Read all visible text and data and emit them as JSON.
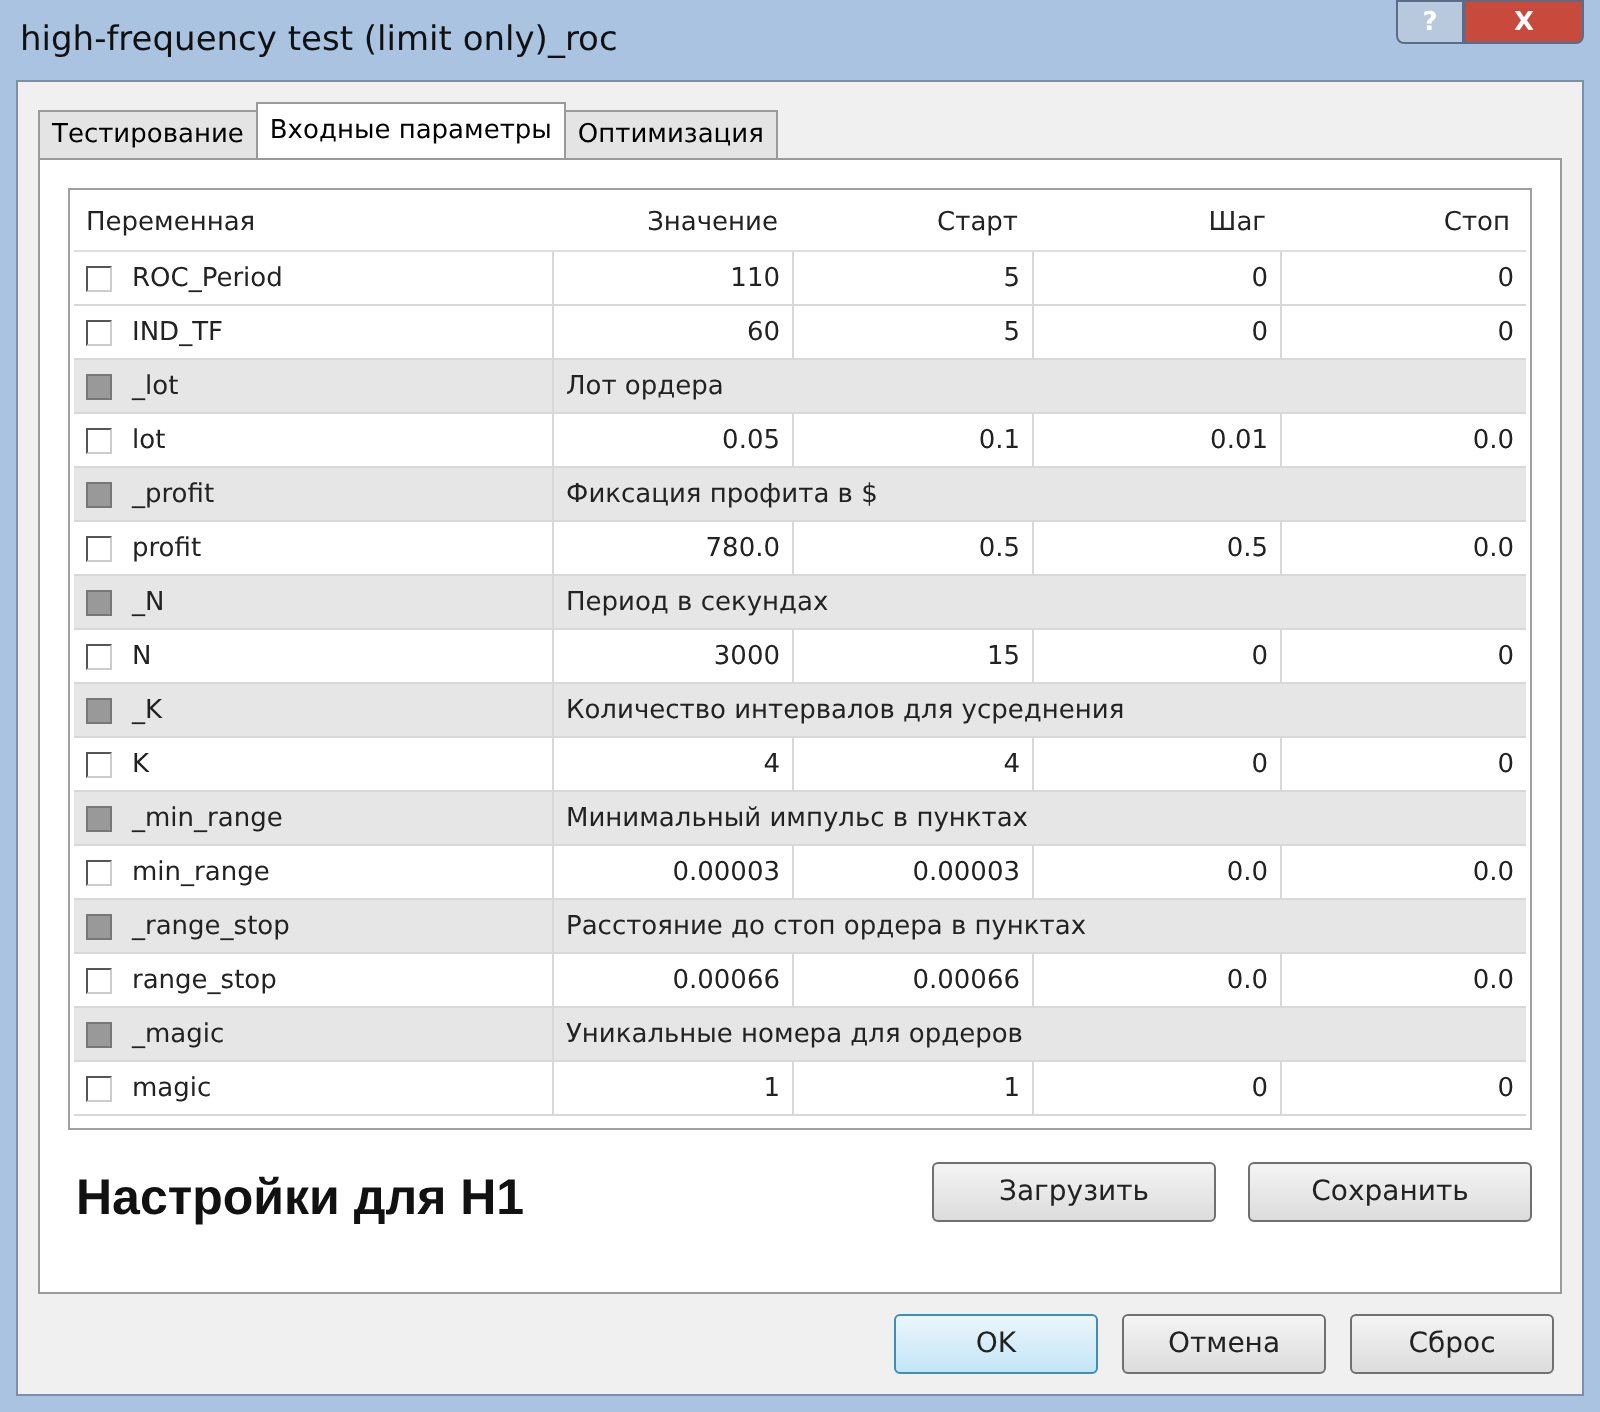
{
  "window": {
    "title": "high-frequency test (limit only)_roc",
    "help_button": "?",
    "close_button": "X"
  },
  "tabs": [
    {
      "label": "Тестирование",
      "selected": false
    },
    {
      "label": "Входные параметры",
      "selected": true
    },
    {
      "label": "Оптимизация",
      "selected": false
    }
  ],
  "table": {
    "columns": [
      "Переменная",
      "Значение",
      "Старт",
      "Шаг",
      "Стоп"
    ],
    "rows": [
      {
        "kind": "param",
        "checked": false,
        "name": "ROC_Period",
        "values": [
          "110",
          "5",
          "0",
          "0"
        ]
      },
      {
        "kind": "param",
        "checked": false,
        "name": "IND_TF",
        "values": [
          "60",
          "5",
          "0",
          "0"
        ]
      },
      {
        "kind": "comment",
        "checked": false,
        "name": "_lot",
        "comment": "Лот ордера"
      },
      {
        "kind": "param",
        "checked": false,
        "name": "lot",
        "values": [
          "0.05",
          "0.1",
          "0.01",
          "0.0"
        ]
      },
      {
        "kind": "comment",
        "checked": false,
        "name": "_profit",
        "comment": "Фиксация профита в $"
      },
      {
        "kind": "param",
        "checked": false,
        "name": "profit",
        "values": [
          "780.0",
          "0.5",
          "0.5",
          "0.0"
        ]
      },
      {
        "kind": "comment",
        "checked": false,
        "name": "_N",
        "comment": "Период в секундах"
      },
      {
        "kind": "param",
        "checked": false,
        "name": "N",
        "values": [
          "3000",
          "15",
          "0",
          "0"
        ]
      },
      {
        "kind": "comment",
        "checked": false,
        "name": "_K",
        "comment": "Количество интервалов для усреднения"
      },
      {
        "kind": "param",
        "checked": false,
        "name": "K",
        "values": [
          "4",
          "4",
          "0",
          "0"
        ]
      },
      {
        "kind": "comment",
        "checked": false,
        "name": "_min_range",
        "comment": "Минимальный импульс в пунктах"
      },
      {
        "kind": "param",
        "checked": false,
        "name": "min_range",
        "values": [
          "0.00003",
          "0.00003",
          "0.0",
          "0.0"
        ]
      },
      {
        "kind": "comment",
        "checked": false,
        "name": "_range_stop",
        "comment": "Расстояние до стоп ордера в пунктах"
      },
      {
        "kind": "param",
        "checked": false,
        "name": "range_stop",
        "values": [
          "0.00066",
          "0.00066",
          "0.0",
          "0.0"
        ]
      },
      {
        "kind": "comment",
        "checked": false,
        "name": "_magic",
        "comment": "Уникальные номера для ордеров"
      },
      {
        "kind": "param",
        "checked": false,
        "name": "magic",
        "values": [
          "1",
          "1",
          "0",
          "0"
        ]
      }
    ]
  },
  "caption": "Настройки для  H1",
  "panel_buttons": [
    "Загрузить",
    "Сохранить"
  ],
  "dialog_buttons": [
    {
      "label": "OK",
      "default": true
    },
    {
      "label": "Отмена",
      "default": false
    },
    {
      "label": "Сброс",
      "default": false
    }
  ]
}
